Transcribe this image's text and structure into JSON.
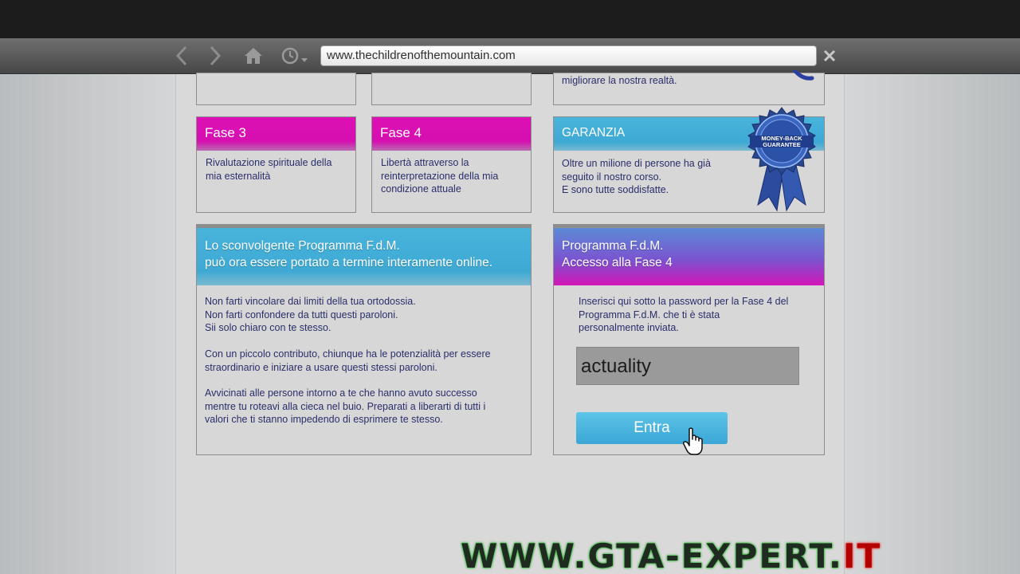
{
  "browser": {
    "url": "www.thechildrenofthemountain.com",
    "icons": {
      "back": "chevron-left-icon",
      "forward": "chevron-right-icon",
      "home": "home-icon",
      "history": "clock-icon",
      "close": "close-icon"
    }
  },
  "page": {
    "top_right_text": "migliorare la nostra realtà.",
    "fase3": {
      "title": "Fase 3",
      "lines": [
        "Rivalutazione spirituale della",
        "mia esternalità"
      ]
    },
    "fase4": {
      "title": "Fase 4",
      "lines": [
        "Libertà attraverso la",
        "reinterpretazione della mia",
        "condizione attuale"
      ]
    },
    "garanzia": {
      "title": "GARANZIA",
      "lines": [
        "Oltre un milione di persone ha già",
        "seguito il nostro corso.",
        "E sono tutte soddisfatte."
      ],
      "badge_line1": "MONEY-BACK",
      "badge_line2": "GUARANTEE"
    },
    "programma": {
      "title_lines": [
        "Lo sconvolgente Programma F.d.M.",
        "può ora essere portato a termine interamente online."
      ],
      "para1": [
        "Non farti vincolare dai limiti della tua ortodossia.",
        "Non farti confondere da tutti questi paroloni.",
        "Sii solo chiaro con te stesso."
      ],
      "para2": [
        "Con un piccolo contributo, chiunque ha le potenzialità per essere",
        "straordinario e iniziare a usare questi stessi paroloni."
      ],
      "para3": [
        "Avvicinati alle persone intorno a te che hanno avuto successo",
        "mentre tu roteavi alla cieca nel buio. Preparati a liberarti di tutti i",
        "valori che ti stanno impedendo di esprimere te stesso."
      ]
    },
    "accesso": {
      "title_lines": [
        "Programma F.d.M.",
        "Accesso alla Fase 4"
      ],
      "instructions": [
        "Inserisci qui sotto la password per la Fase 4 del",
        "Programma F.d.M. che ti è stata",
        "personalmente inviata."
      ],
      "password_value": "actuality",
      "submit_label": "Entra"
    }
  },
  "watermark": {
    "main": "WWW.GTA-EXPERT.",
    "suffix": "IT"
  },
  "colors": {
    "magenta_header": "#d50fb0",
    "blue_header": "#3ea9d4",
    "body_text": "#2a2e6a",
    "button": "#3aa6d6"
  }
}
